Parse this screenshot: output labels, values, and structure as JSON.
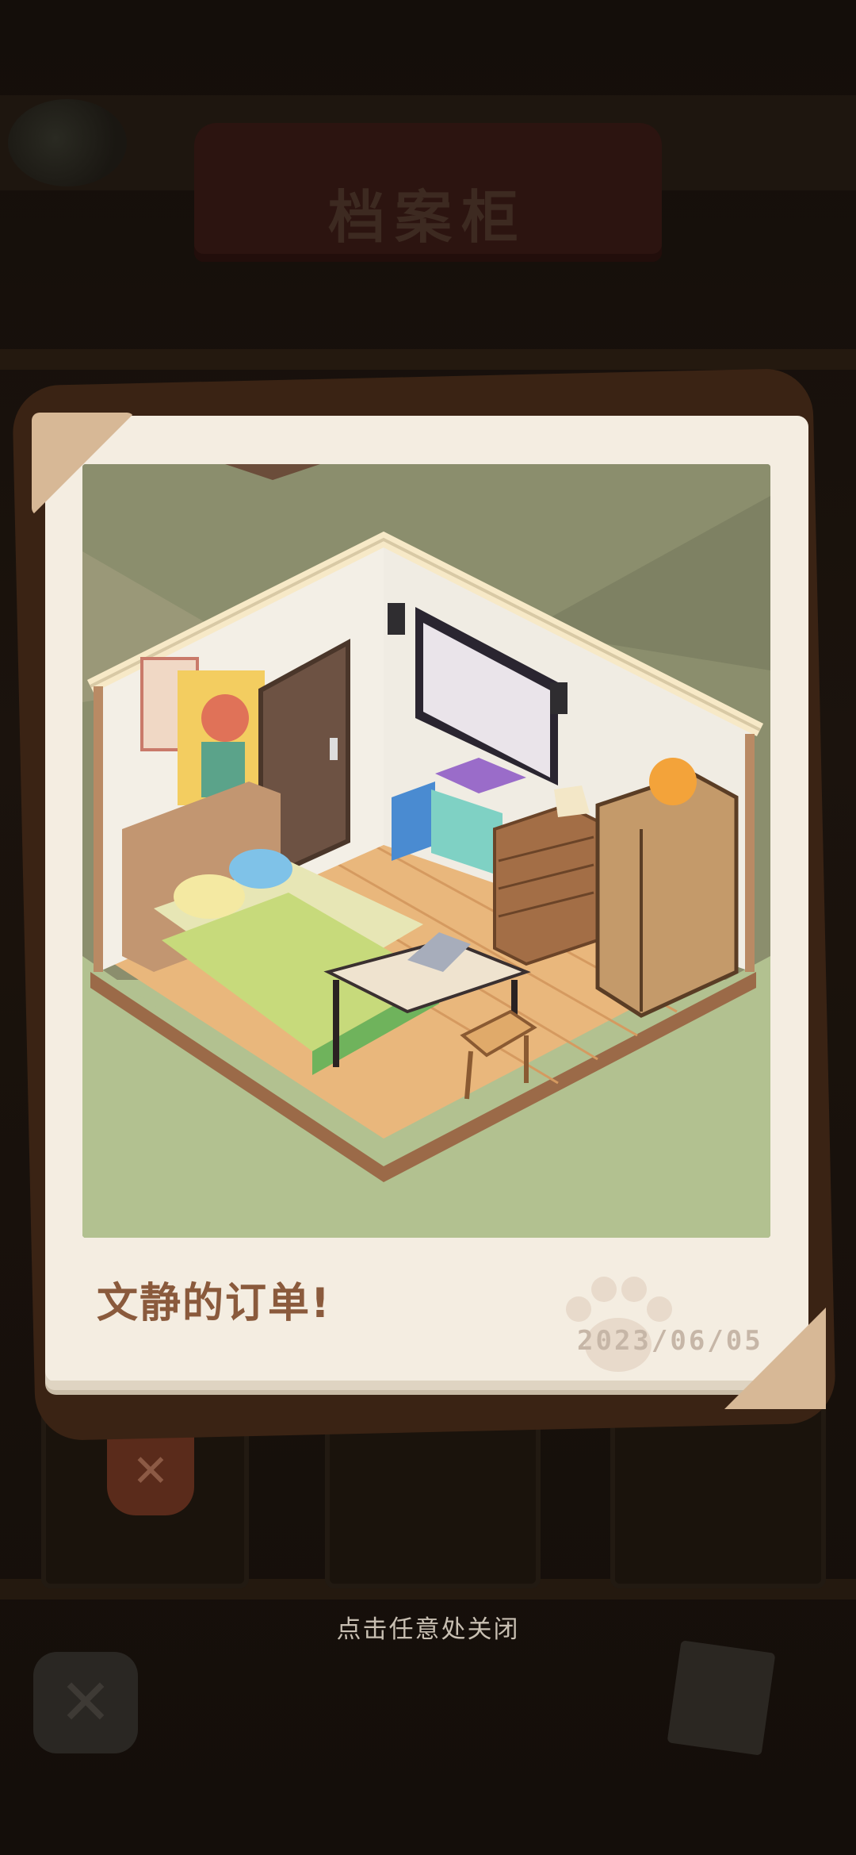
{
  "background": {
    "title": "档案柜",
    "close_icon": "close-icon"
  },
  "photo": {
    "caption": "文静的订单!",
    "date": "2023/06/05",
    "stamp_icon": "paw-print-icon",
    "scene": "isometric-bedroom-illustration"
  },
  "overlay": {
    "dismiss_hint": "点击任意处关闭"
  }
}
